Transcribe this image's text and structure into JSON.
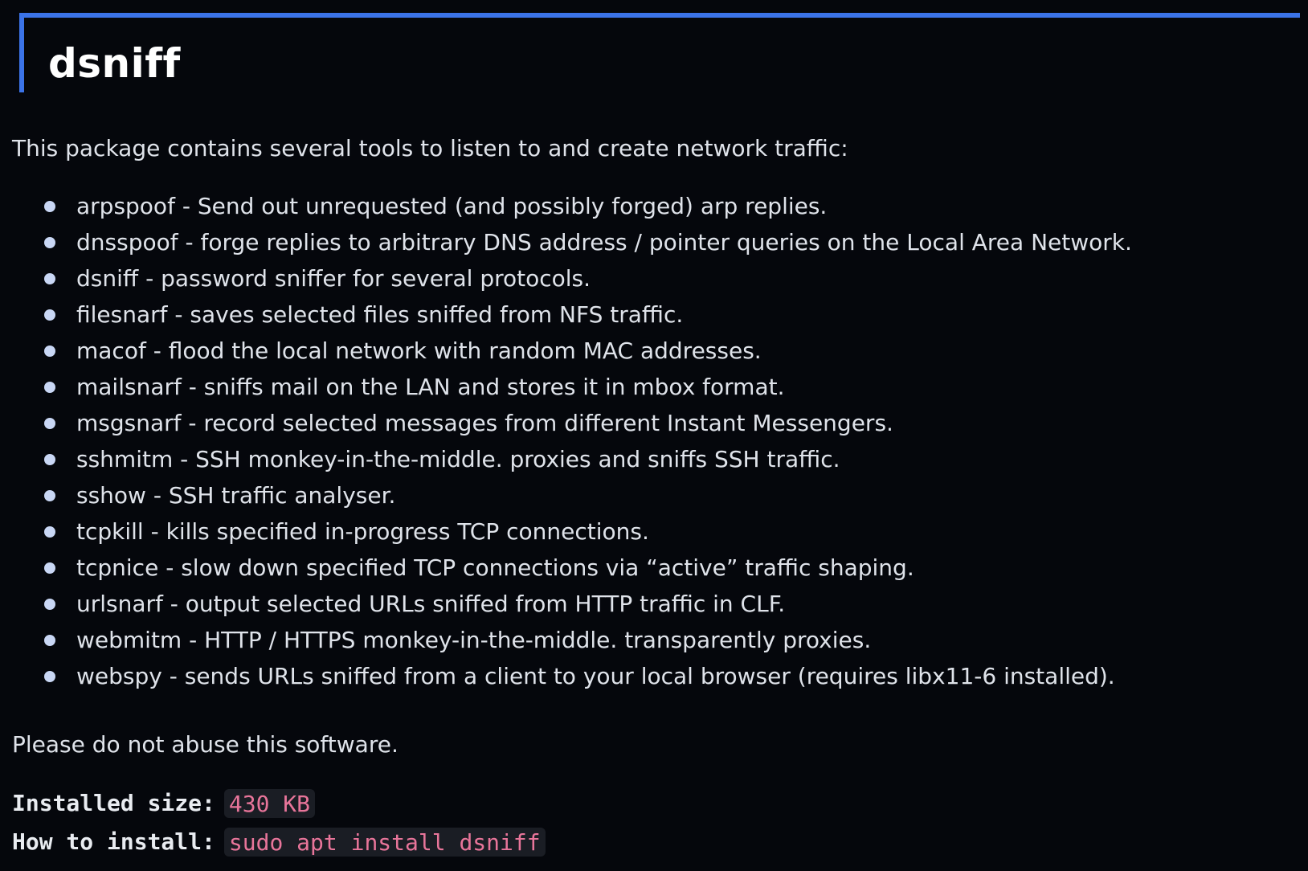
{
  "header": {
    "title": "dsniff"
  },
  "description": {
    "intro": "This package contains several tools to listen to and create network traffic:",
    "tools": [
      "arpspoof - Send out unrequested (and possibly forged) arp replies.",
      "dnsspoof - forge replies to arbitrary DNS address / pointer queries on the Local Area Network.",
      "dsniff - password sniffer for several protocols.",
      "filesnarf - saves selected files sniffed from NFS traffic.",
      "macof - flood the local network with random MAC addresses.",
      "mailsnarf - sniffs mail on the LAN and stores it in mbox format.",
      "msgsnarf - record selected messages from different Instant Messengers.",
      "sshmitm - SSH monkey-in-the-middle. proxies and sniffs SSH traffic.",
      "sshow - SSH traffic analyser.",
      "tcpkill - kills specified in-progress TCP connections.",
      "tcpnice - slow down specified TCP connections via “active” traffic shaping.",
      "urlsnarf - output selected URLs sniffed from HTTP traffic in CLF.",
      "webmitm - HTTP / HTTPS monkey-in-the-middle. transparently proxies.",
      "webspy - sends URLs sniffed from a client to your local browser (requires libx11-6 installed)."
    ],
    "warning": "Please do not abuse this software."
  },
  "meta": {
    "size_label": "Installed size:",
    "size_value": "430 KB",
    "install_label": "How to install:",
    "install_value": "sudo apt install dsniff"
  },
  "colors": {
    "background": "#05070c",
    "accent": "#3b73e8",
    "code_text": "#e8759a",
    "code_background": "#1a1d24",
    "bullet": "#c9d7f5"
  }
}
